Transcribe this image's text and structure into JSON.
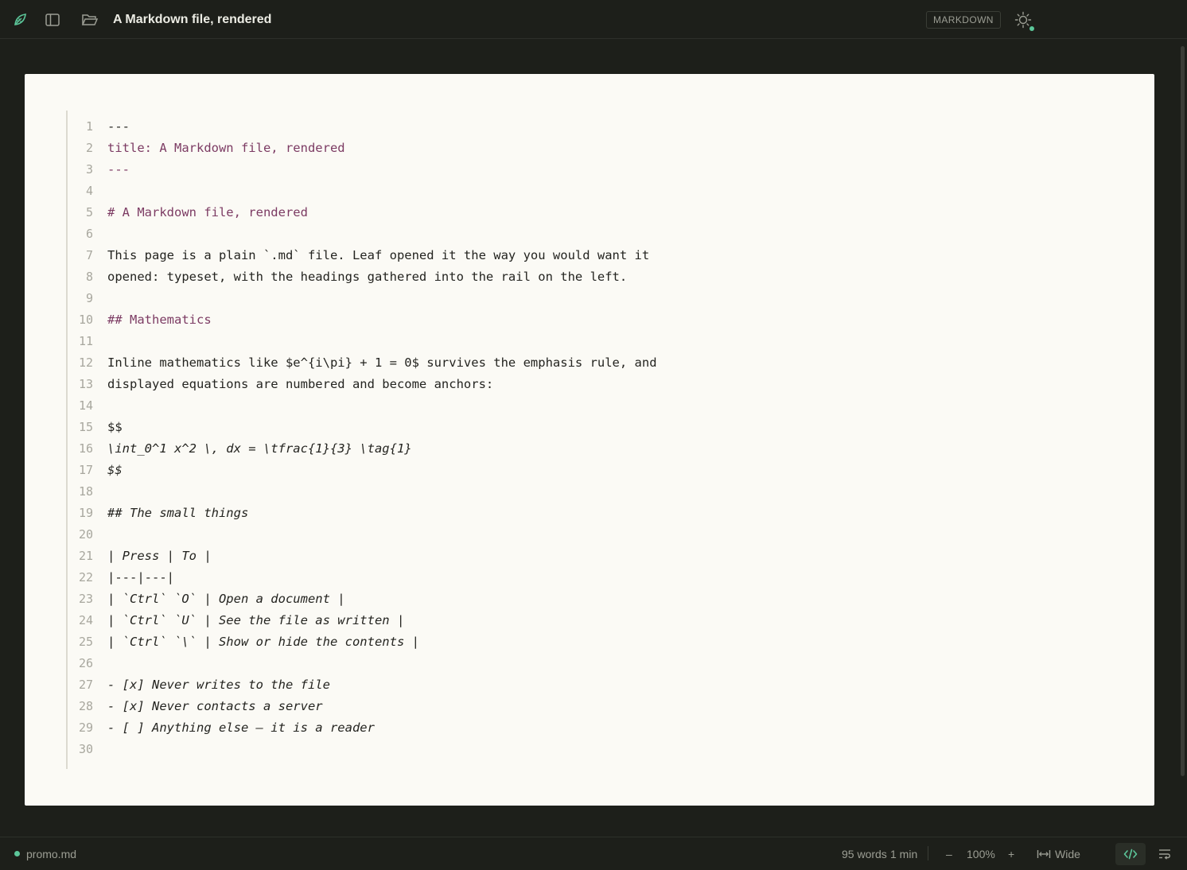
{
  "app": {
    "title": "A Markdown file, rendered",
    "mode": "MARKDOWN",
    "accent": "#5cc79a"
  },
  "toolbar": {
    "icons": [
      "leaf-logo-icon",
      "sidebar-toggle-icon",
      "folder-open-icon",
      "sun-icon"
    ]
  },
  "editor": {
    "lines": [
      {
        "n": "1",
        "text": "---",
        "style": "plain"
      },
      {
        "n": "2",
        "text": "title: A Markdown file, rendered",
        "style": "meta"
      },
      {
        "n": "3",
        "text": "---",
        "style": "meta"
      },
      {
        "n": "4",
        "text": "",
        "style": "plain"
      },
      {
        "n": "5",
        "text": "# A Markdown file, rendered",
        "style": "head"
      },
      {
        "n": "6",
        "text": "",
        "style": "plain"
      },
      {
        "n": "7",
        "text": "This page is a plain `.md` file. Leaf opened it the way you would want it",
        "style": "plain"
      },
      {
        "n": "8",
        "text": "opened: typeset, with the headings gathered into the rail on the left.",
        "style": "plain"
      },
      {
        "n": "9",
        "text": "",
        "style": "plain"
      },
      {
        "n": "10",
        "text": "## Mathematics",
        "style": "head"
      },
      {
        "n": "11",
        "text": "",
        "style": "plain"
      },
      {
        "n": "12",
        "text": "Inline mathematics like $e^{i\\pi} + 1 = 0$ survives the emphasis rule, and",
        "style": "plain"
      },
      {
        "n": "13",
        "text": "displayed equations are numbered and become anchors:",
        "style": "plain"
      },
      {
        "n": "14",
        "text": "",
        "style": "plain"
      },
      {
        "n": "15",
        "text": "$$",
        "style": "plain"
      },
      {
        "n": "16",
        "text": "\\int_0^1 x^2 \\, dx = \\tfrac{1}{3} \\tag{1}",
        "style": "italic"
      },
      {
        "n": "17",
        "text": "$$",
        "style": "italic"
      },
      {
        "n": "18",
        "text": "",
        "style": "plain"
      },
      {
        "n": "19",
        "text": "## The small things",
        "style": "italic"
      },
      {
        "n": "20",
        "text": "",
        "style": "plain"
      },
      {
        "n": "21",
        "text": "| Press | To |",
        "style": "italic"
      },
      {
        "n": "22",
        "text": "|---|---|",
        "style": "plain"
      },
      {
        "n": "23",
        "text": "| `Ctrl` `O` | Open a document |",
        "style": "italic"
      },
      {
        "n": "24",
        "text": "| `Ctrl` `U` | See the file as written |",
        "style": "italic"
      },
      {
        "n": "25",
        "text": "| `Ctrl` `\\` | Show or hide the contents |",
        "style": "italic"
      },
      {
        "n": "26",
        "text": "",
        "style": "plain"
      },
      {
        "n": "27",
        "text": "- [x] Never writes to the file",
        "style": "italic"
      },
      {
        "n": "28",
        "text": "- [x] Never contacts a server",
        "style": "italic"
      },
      {
        "n": "29",
        "text": "- [ ] Anything else — it is a reader",
        "style": "italic"
      },
      {
        "n": "30",
        "text": "",
        "style": "plain"
      }
    ]
  },
  "status": {
    "filename": "promo.md",
    "words": "95 words",
    "reading_time": "1 min",
    "zoom_out": "–",
    "zoom": "100%",
    "zoom_in": "+",
    "width_label": "Wide"
  }
}
